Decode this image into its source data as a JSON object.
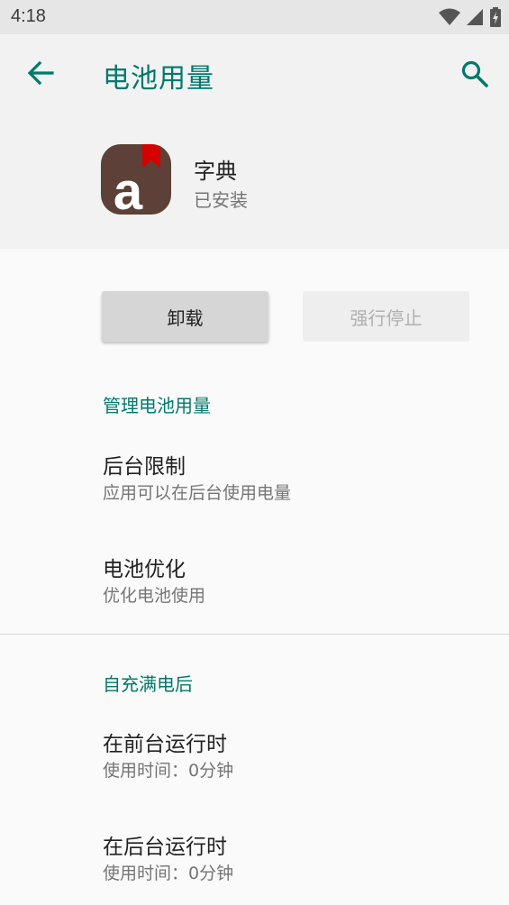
{
  "status_bar": {
    "time": "4:18"
  },
  "app_bar": {
    "title": "电池用量"
  },
  "app": {
    "name": "字典",
    "status": "已安装",
    "icon_letter": "a"
  },
  "buttons": {
    "uninstall": "卸载",
    "force_stop": "强行停止"
  },
  "manage": {
    "heading": "管理电池用量",
    "items": [
      {
        "title": "后台限制",
        "subtitle": "应用可以在后台使用电量"
      },
      {
        "title": "电池优化",
        "subtitle": "优化电池使用"
      }
    ]
  },
  "since_full_charge": {
    "heading": "自充满电后",
    "items": [
      {
        "title": "在前台运行时",
        "subtitle": "使用时间：0分钟"
      },
      {
        "title": "在后台运行时",
        "subtitle": "使用时间：0分钟"
      }
    ]
  },
  "colors": {
    "accent": "#00796b",
    "app_icon_bg": "#5d4037",
    "bookmark": "#d50000"
  }
}
